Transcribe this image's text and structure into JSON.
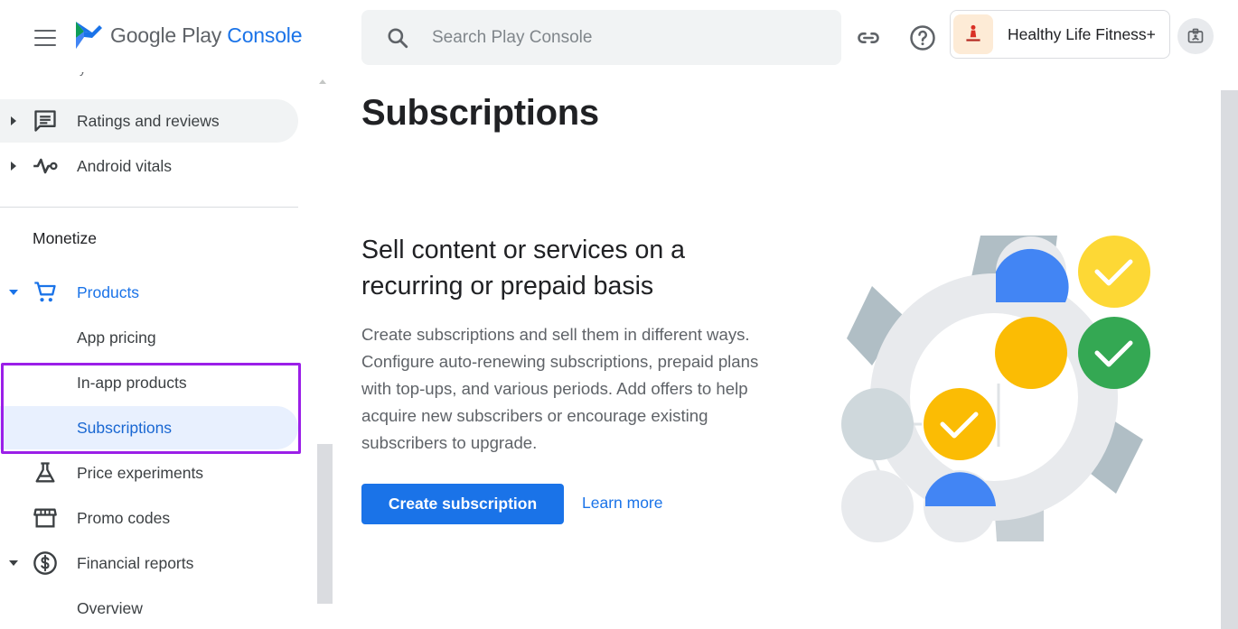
{
  "header": {
    "logo_text_plain": "Google Play ",
    "logo_text_accent": "Console",
    "search_placeholder": "Search Play Console",
    "app_name": "Healthy Life Fitness+"
  },
  "sidebar": {
    "cut_off_text": "y",
    "items_top": [
      {
        "label": "Ratings and reviews",
        "icon": "reviews-icon"
      },
      {
        "label": "Android vitals",
        "icon": "vitals-icon"
      }
    ],
    "section_title": "Monetize",
    "products": {
      "label": "Products",
      "icon": "cart-icon"
    },
    "product_children": [
      {
        "label": "App pricing"
      },
      {
        "label": "In-app products"
      },
      {
        "label": "Subscriptions"
      }
    ],
    "items_bottom": [
      {
        "label": "Price experiments",
        "icon": "flask-icon"
      },
      {
        "label": "Promo codes",
        "icon": "store-icon"
      },
      {
        "label": "Financial reports",
        "icon": "dollar-icon"
      }
    ],
    "financial_children": [
      {
        "label": "Overview"
      }
    ]
  },
  "main": {
    "title": "Subscriptions",
    "headline": "Sell content or services on a recurring or prepaid basis",
    "description": "Create subscriptions and sell them in different ways. Configure auto-renewing subscriptions, prepaid plans with top-ups, and various periods. Add offers to help acquire new subscribers or encourage existing subscribers to upgrade.",
    "primary_button": "Create subscription",
    "link": "Learn more"
  },
  "colors": {
    "accent": "#1a73e8",
    "selected_bg": "#e8f0fe",
    "highlight_outline": "#9b1fe8",
    "yellow": "#fbbc04",
    "green": "#34a853",
    "blue": "#4285f4"
  }
}
